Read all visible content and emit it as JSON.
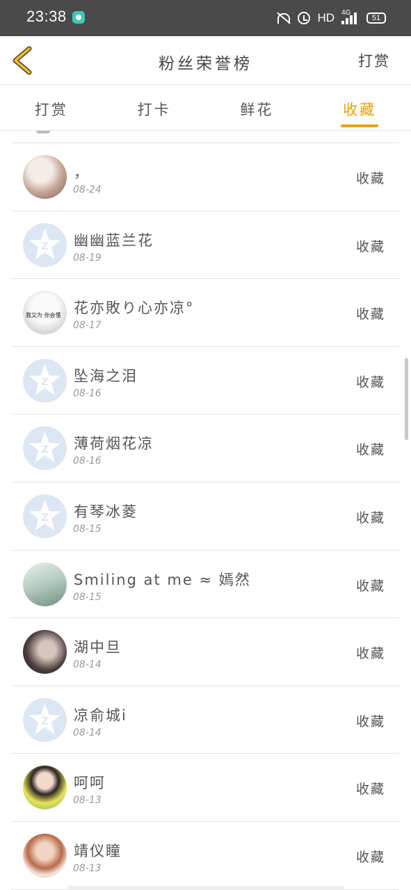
{
  "status_bar": {
    "time": "23:38",
    "hd": "HD",
    "network": "4G",
    "battery": "51"
  },
  "header": {
    "title": "粉丝荣誉榜",
    "action": "打赏"
  },
  "tabs": [
    {
      "label": "打赏",
      "active": false
    },
    {
      "label": "打卡",
      "active": false
    },
    {
      "label": "鲜花",
      "active": false
    },
    {
      "label": "收藏",
      "active": true
    }
  ],
  "colors": {
    "accent": "#e6a000",
    "status_bar": "#4a4a4a",
    "default_avatar": "#dde6f3"
  },
  "list": [
    {
      "name": "，",
      "date": "08-24",
      "action": "收藏",
      "avatar": "photo"
    },
    {
      "name": "幽幽蓝兰花",
      "date": "08-19",
      "action": "收藏",
      "avatar": "default-qzone-icon"
    },
    {
      "name": "花亦敗り心亦凉°",
      "date": "08-17",
      "action": "收藏",
      "avatar": "photo",
      "avatar_text": "我又为  你会懂"
    },
    {
      "name": "坠海之泪",
      "date": "08-16",
      "action": "收藏",
      "avatar": "default-qzone-icon"
    },
    {
      "name": "薄荷烟花凉",
      "date": "08-16",
      "action": "收藏",
      "avatar": "default-qzone-icon"
    },
    {
      "name": "有琴冰菱",
      "date": "08-15",
      "action": "收藏",
      "avatar": "default-qzone-icon"
    },
    {
      "name": "Smiling at me ≈ 嫣然",
      "date": "08-15",
      "action": "收藏",
      "avatar": "photo"
    },
    {
      "name": "湖中旦",
      "date": "08-14",
      "action": "收藏",
      "avatar": "photo"
    },
    {
      "name": "凉俞城i",
      "date": "08-14",
      "action": "收藏",
      "avatar": "default-qzone-icon"
    },
    {
      "name": "呵呵",
      "date": "08-13",
      "action": "收藏",
      "avatar": "photo"
    },
    {
      "name": "靖仪瞳",
      "date": "08-13",
      "action": "收藏",
      "avatar": "photo"
    }
  ]
}
